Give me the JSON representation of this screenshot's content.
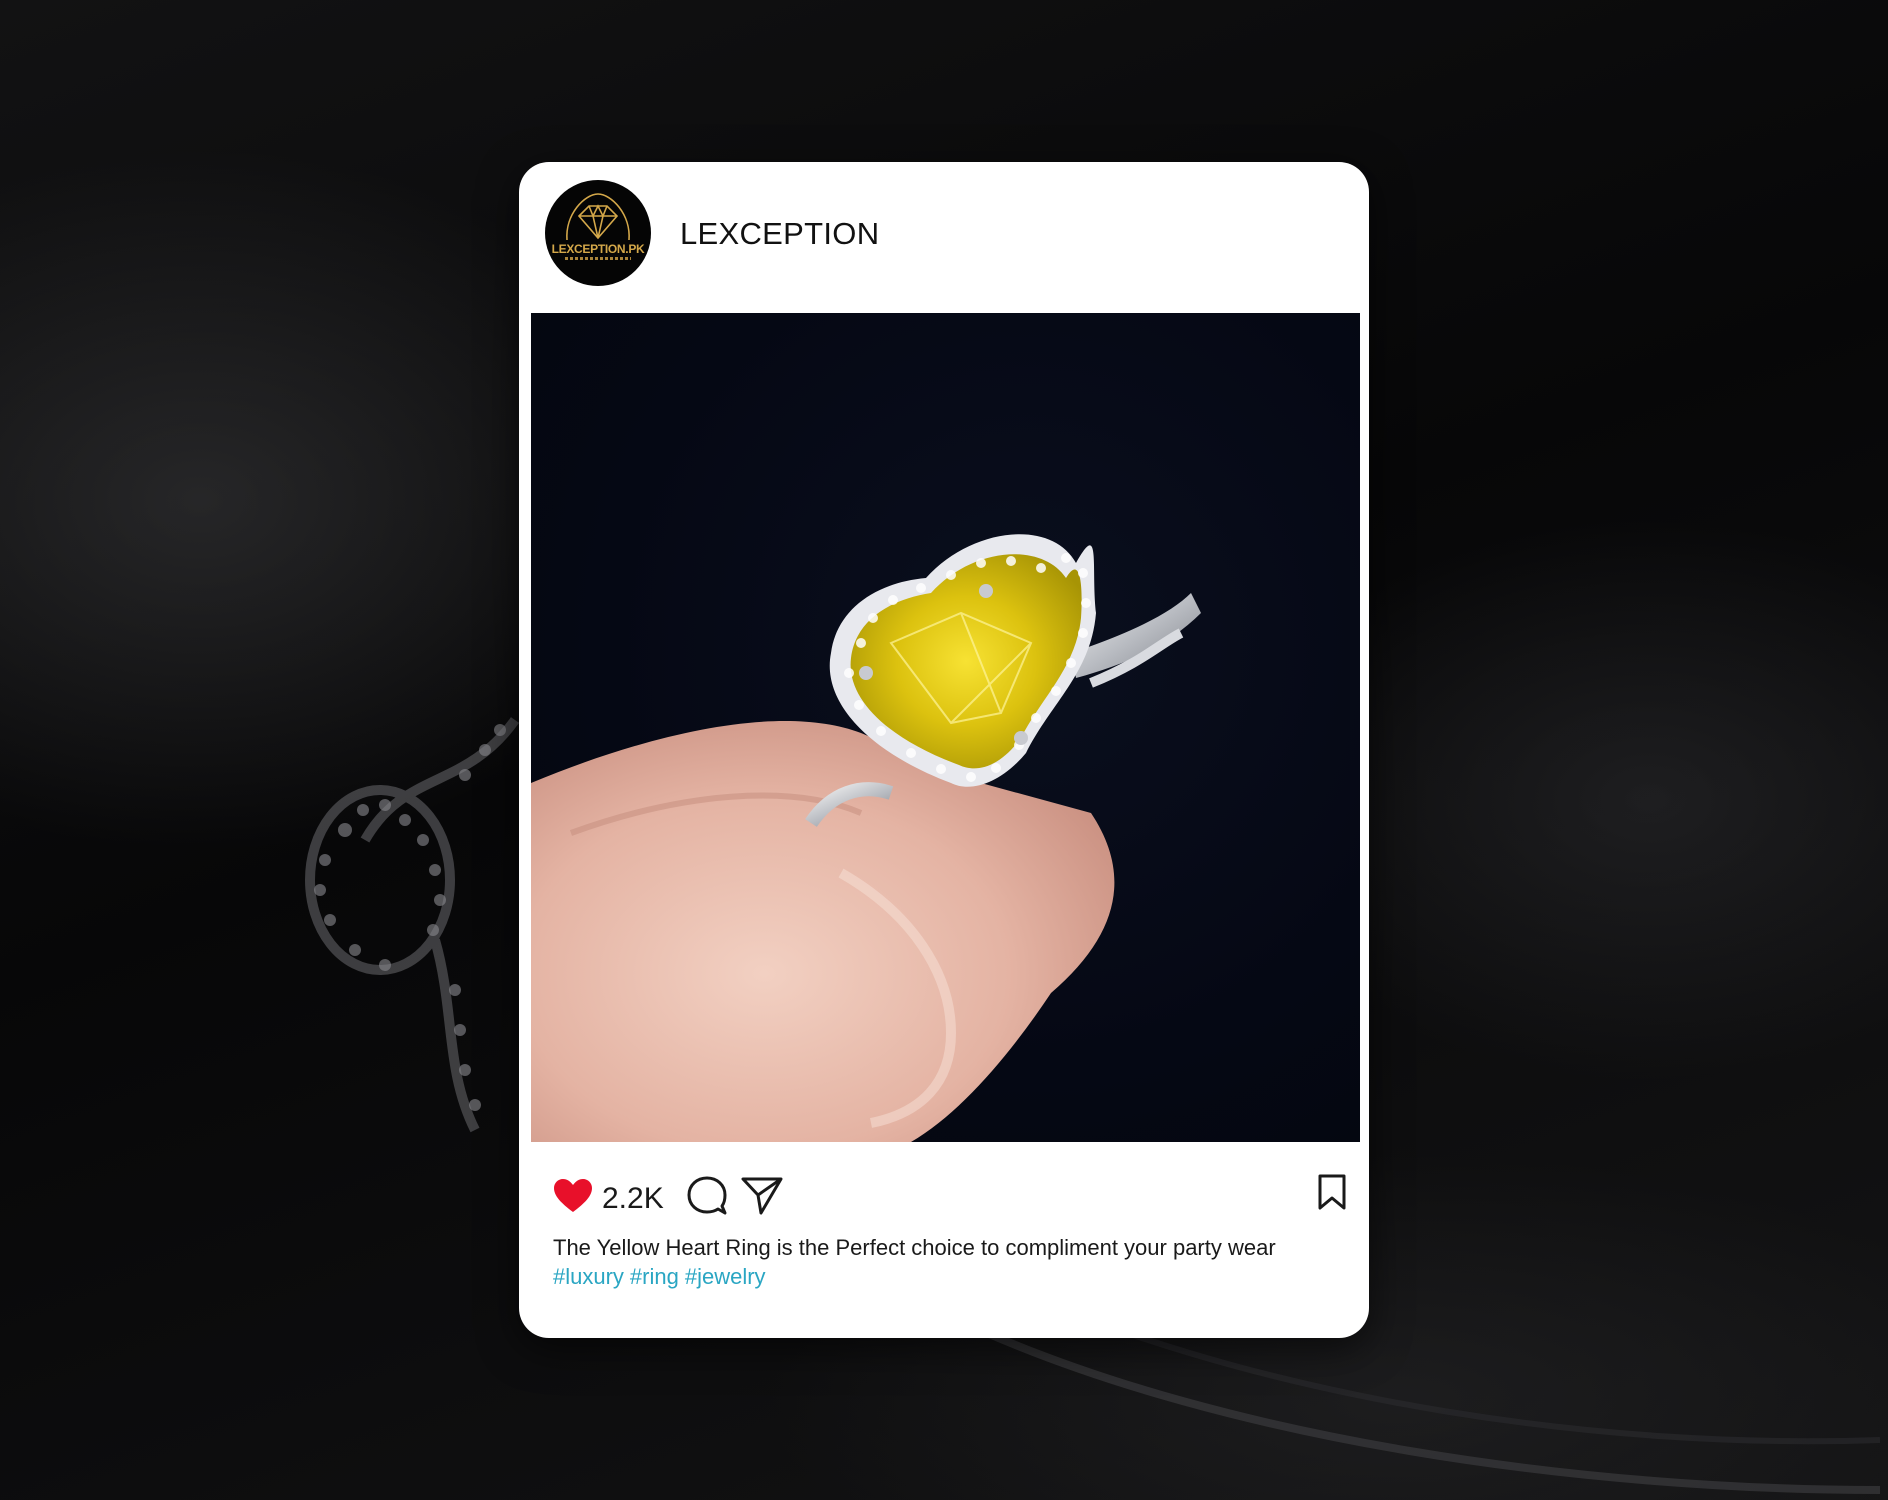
{
  "post": {
    "username": "LEXCEPTION",
    "avatar": {
      "logo_text": "LEXCEPTION.PK",
      "icon": "diamond-logo"
    },
    "likes": "2.2K",
    "caption": "The Yellow Heart Ring is the Perfect choice to compliment your party wear",
    "hashtags": [
      "#luxury",
      "#ring",
      "#jewelry"
    ],
    "icons": {
      "like": "heart-icon",
      "comment": "comment-icon",
      "share": "send-icon",
      "save": "bookmark-icon"
    },
    "colors": {
      "like": "#e8102a",
      "hashtag": "#2aa6c3",
      "card": "#ffffff",
      "logo_gold": "#d4a84a"
    }
  }
}
